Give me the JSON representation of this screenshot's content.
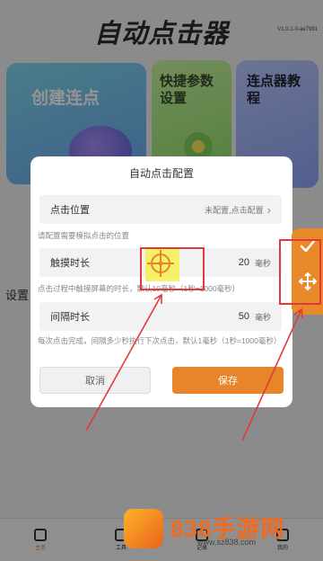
{
  "app": {
    "title": "自动点击器",
    "version": "V1.0.1-0-ae7991",
    "cards": {
      "create": "创建连点",
      "quick": "快捷参数设置",
      "tutorial": "连点器教程"
    },
    "settings_label": "设置",
    "nav": [
      {
        "label": "主页",
        "icon": "home-icon"
      },
      {
        "label": "工具",
        "icon": "tools-icon"
      },
      {
        "label": "记录",
        "icon": "record-icon"
      },
      {
        "label": "我的",
        "icon": "profile-icon"
      }
    ]
  },
  "dialog": {
    "title": "自动点击配置",
    "position": {
      "label": "点击位置",
      "status": "未配置,点击配置",
      "hint": "请配置需要模拟点击的位置"
    },
    "touch": {
      "label": "触摸时长",
      "value": "20",
      "unit": "毫秒",
      "hint": "点击过程中触摸屏幕的时长，默认10毫秒（1秒=1000毫秒）"
    },
    "interval": {
      "label": "间隔时长",
      "value": "50",
      "unit": "毫秒",
      "hint": "每次点击完成，间隔多少秒执行下次点击，默认1毫秒（1秒=1000毫秒）"
    },
    "cancel": "取消",
    "save": "保存"
  },
  "float": {
    "confirm_icon": "check-icon",
    "move_icon": "move-icon"
  },
  "watermark": {
    "brand": "838手游网",
    "url": "www.sz838.com"
  },
  "colors": {
    "accent": "#e8842a",
    "highlight": "#e23a3a"
  }
}
